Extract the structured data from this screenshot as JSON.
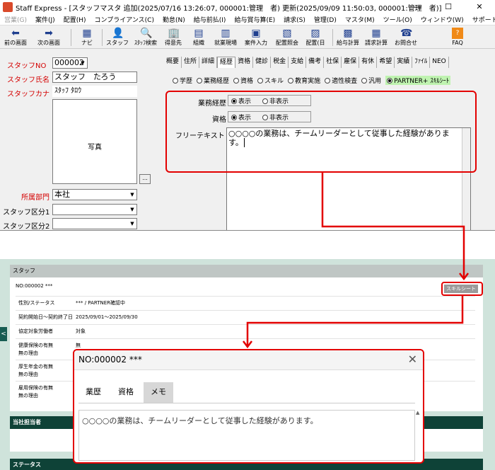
{
  "window": {
    "title": "Staff Express - [スタッフマスタ 追加(2025/07/16 13:26:07, 000001:管理　者) 更新(2025/09/09 11:50:03, 000001:管理　者)]",
    "controls": {
      "minimize": "—",
      "maximize": "☐",
      "close": "✕"
    }
  },
  "menu": [
    "営業(G)",
    "案件(J)",
    "配置(H)",
    "コンプライアンス(C)",
    "勤怠(N)",
    "給与前払(I)",
    "給与賞与算(E)",
    "請求(S)",
    "管理(D)",
    "マスタ(M)",
    "ツール(O)",
    "ウィンドウ(W)",
    "サポート(H)"
  ],
  "toolbar": {
    "prev": "前の画面",
    "next": "次の画面",
    "navi": "ナビ",
    "staff": "スタッフ",
    "staff_search": "ｽﾀｯﾌ検索",
    "client": "得意先",
    "org": "組織",
    "site": "就業現場",
    "case_input": "案件入力",
    "place_ref": "配置照会",
    "place_day": "配置(日",
    "salary_calc": "給与計算",
    "bill_calc": "請求計算",
    "contact": "お問合せ",
    "faq": "FAQ"
  },
  "form": {
    "staff_no_label": "スタッフNO",
    "staff_no_value": "000002",
    "name_label": "スタッフ氏名",
    "name_value": "スタッフ　たろう",
    "kana_label": "スタッフカナ",
    "kana_value": "ｽﾀｯﾌ ﾀﾛｳ",
    "photo_label": "写真",
    "photo_button": "...",
    "dept_label": "所属部門",
    "dept_value": "本社",
    "class1_label": "スタッフ区分1",
    "class2_label": "スタッフ区分2"
  },
  "tabs": [
    "概要",
    "住所",
    "詳細",
    "経歴",
    "資格",
    "健診",
    "税金",
    "支給",
    "備考",
    "社保",
    "雇保",
    "有休",
    "希望",
    "実績",
    "ﾌｧｲﾙ",
    "NEO"
  ],
  "active_tab": "経歴",
  "subtabs": [
    "学歴",
    "業務経歴",
    "資格",
    "スキル",
    "教育実施",
    "適性検査",
    "汎用",
    "PARTNER+ ｽｷﾙｼｰﾄ"
  ],
  "settings": {
    "work_history_label": "業務経歴",
    "qual_label": "資格",
    "show": "表示",
    "hide": "非表示",
    "free_text_label": "フリーテキスト",
    "free_text_value": "○○○○の業務は、チームリーダーとして従事した経験があります。"
  },
  "web": {
    "header": "スタッフ",
    "record_no": "NO:000002 ***",
    "skill_sheet_button": "スキルシート",
    "fields": [
      {
        "key": "性別/ステータス",
        "value": "*** / PARTNER確認中"
      },
      {
        "key": "契約開始日～契約終了日",
        "value": "2025/09/01～2025/09/30"
      },
      {
        "key": "協定対象労働者",
        "value": "対象"
      },
      {
        "key": "健康保険の有無",
        "key2": "無の理由",
        "value": "無"
      },
      {
        "key": "厚生年金の有無",
        "key2": "無の理由",
        "value": ""
      },
      {
        "key": "雇用保険の有無",
        "key2": "無の理由",
        "value": ""
      }
    ],
    "section_manager": "当社担当者",
    "section_status": "ステータス",
    "left_arrow": "<"
  },
  "modal": {
    "title": "NO:000002 ***",
    "close": "✕",
    "tabs": [
      "業歴",
      "資格",
      "メモ"
    ],
    "active_tab": "メモ",
    "memo_text": "○○○○の業務は、チームリーダーとして従事した経験があります。",
    "scroll_up": "▲"
  },
  "colors": {
    "highlight": "#e30000",
    "web_dark": "#0e4237",
    "web_bg": "#cfe3db"
  }
}
